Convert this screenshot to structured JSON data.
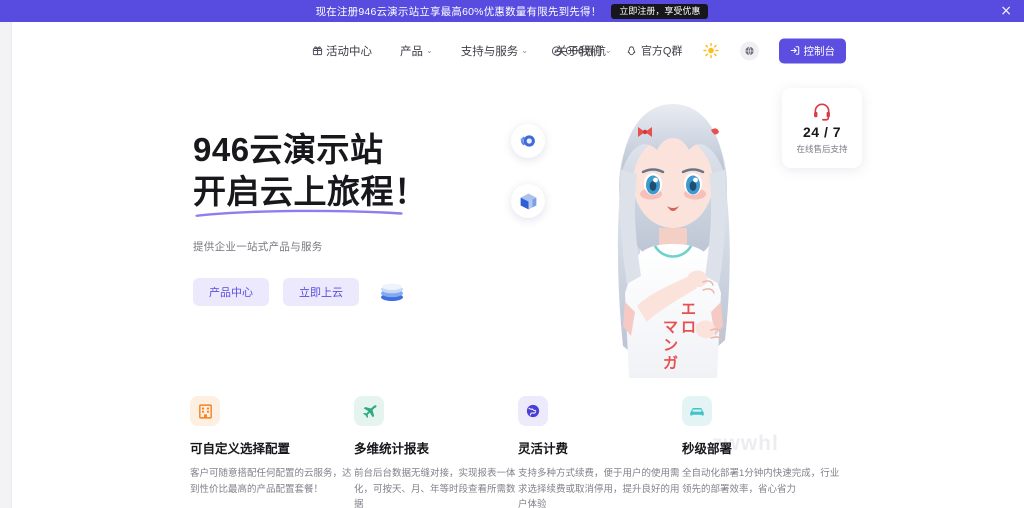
{
  "promo": {
    "text": "现在注册946云演示站立享最高60%优惠数量有限先到先得！",
    "button": "立即注册，享受优惠",
    "close": "×",
    "bg_color": "#584ce0"
  },
  "nav": {
    "center_items": [
      {
        "label": "活动中心",
        "icon": "gift-icon",
        "has_dropdown": false
      },
      {
        "label": "产品",
        "icon": "",
        "has_dropdown": true,
        "chevron": "⌄"
      },
      {
        "label": "支持与服务",
        "icon": "",
        "has_dropdown": true,
        "chevron": "⌄"
      },
      {
        "label": "关于我们",
        "icon": "",
        "has_dropdown": true,
        "chevron": "⌄"
      }
    ],
    "right_links": [
      {
        "label": "006导航",
        "icon": "compass-icon"
      },
      {
        "label": "官方Q群",
        "icon": "penguin-icon"
      }
    ],
    "theme_toggle": "sun-icon",
    "language": "globe-icon",
    "console_button": "控制台",
    "console_color": "#5b4ee0"
  },
  "hero": {
    "title_line1": "946云演示站",
    "title_line2": "开启云上旅程！",
    "subtitle": "提供企业一站式产品与服务",
    "buttons": [
      {
        "label": "产品中心"
      },
      {
        "label": "立即上云"
      }
    ],
    "watermark": "zwwhl",
    "accent_color": "#5b4ee0",
    "floating_badges": [
      {
        "icon": "cloud-disc-icon"
      },
      {
        "icon": "cube-icon"
      }
    ],
    "character": {
      "shirt_text_1": "エ",
      "shirt_text_2": "ロ",
      "shirt_text_3": "マ",
      "shirt_text_4": "ン",
      "shirt_text_5": "ガ"
    }
  },
  "support_card": {
    "icon": "headset-icon",
    "number": "24 / 7",
    "label": "在线售后支持",
    "icon_color": "#d93a47"
  },
  "features": [
    {
      "icon": "building-icon",
      "icon_color": "#f5821f",
      "icon_bg": "#fdefe2",
      "title": "可自定义选择配置",
      "desc": "客户可随意搭配任何配置的云服务，达到性价比最高的产品配置套餐！"
    },
    {
      "icon": "plane-icon",
      "icon_color": "#2bab7e",
      "icon_bg": "#e6f4ef",
      "title": "多维统计报表",
      "desc": "前台后台数据无缝对接，实现报表一体化，可按天、月、年等时段查看所需数据"
    },
    {
      "icon": "globe-feature-icon",
      "icon_color": "#4b3fd6",
      "icon_bg": "#eceafb",
      "title": "灵活计费",
      "desc": "支持多种方式续费，便于用户的使用需求选择续费或取消停用，提升良好的用户体验"
    },
    {
      "icon": "car-icon",
      "icon_color": "#3ec3c9",
      "icon_bg": "#e4f4f5",
      "title": "秒级部署",
      "desc": "全自动化部署1分钟内快速完成，行业领先的部署效率，省心省力"
    }
  ]
}
